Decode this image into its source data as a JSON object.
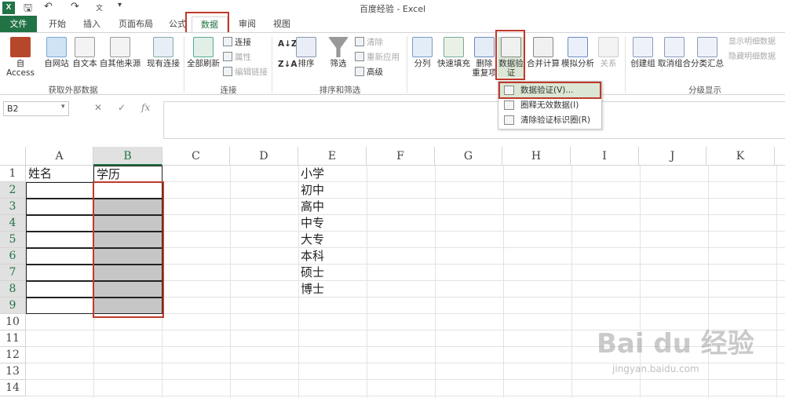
{
  "window": {
    "title": "百度经验 - Excel",
    "excel_icon": "X"
  },
  "tabs": [
    "文件",
    "开始",
    "插入",
    "页面布局",
    "公式",
    "数据",
    "审阅",
    "视图"
  ],
  "ribbon": {
    "get_external": {
      "buttons": [
        "自 Access",
        "自网站",
        "自文本",
        "自其他来源"
      ],
      "label": "获取外部数据"
    },
    "existing": "现有连接",
    "connections": {
      "refresh_all": "全部刷新",
      "items": [
        "连接",
        "属性",
        "编辑链接"
      ],
      "label": "连接"
    },
    "sort_filter": {
      "sort": "排序",
      "filter": "筛选",
      "items": [
        "清除",
        "重新应用",
        "高级"
      ],
      "label": "排序和筛选"
    },
    "tools": {
      "split": "分列",
      "flash_fill": "快速填充",
      "remove_dup_1": "删除",
      "remove_dup_2": "重复项",
      "validation_1": "数据验",
      "validation_2": "证",
      "consolidate": "合并计算",
      "what_if": "模拟分析",
      "relations": "关系"
    },
    "outline": {
      "group": "创建组",
      "ungroup": "取消组合",
      "subtotal": "分类汇总",
      "items": [
        "显示明细数据",
        "隐藏明细数据"
      ],
      "label": "分级显示"
    }
  },
  "dropdown": [
    "数据验证(V)...",
    "圈释无效数据(I)",
    "清除验证标识圈(R)"
  ],
  "formula_bar": {
    "name_box": "B2",
    "fx": "fx"
  },
  "columns": [
    "A",
    "B",
    "C",
    "D",
    "E",
    "F",
    "G",
    "H",
    "I",
    "J",
    "K"
  ],
  "rows": [
    "1",
    "2",
    "3",
    "4",
    "5",
    "6",
    "7",
    "8",
    "9",
    "10",
    "11",
    "12",
    "13",
    "14"
  ],
  "cells": {
    "A1": "姓名",
    "B1": "学历",
    "E": [
      "小学",
      "初中",
      "高中",
      "中专",
      "大专",
      "本科",
      "硕士",
      "博士"
    ]
  },
  "watermark": {
    "main": "Bai du 经验",
    "sub": "jingyan.baidu.com"
  },
  "colors": {
    "excel_green": "#217346",
    "highlight_red": "#c0392b"
  }
}
